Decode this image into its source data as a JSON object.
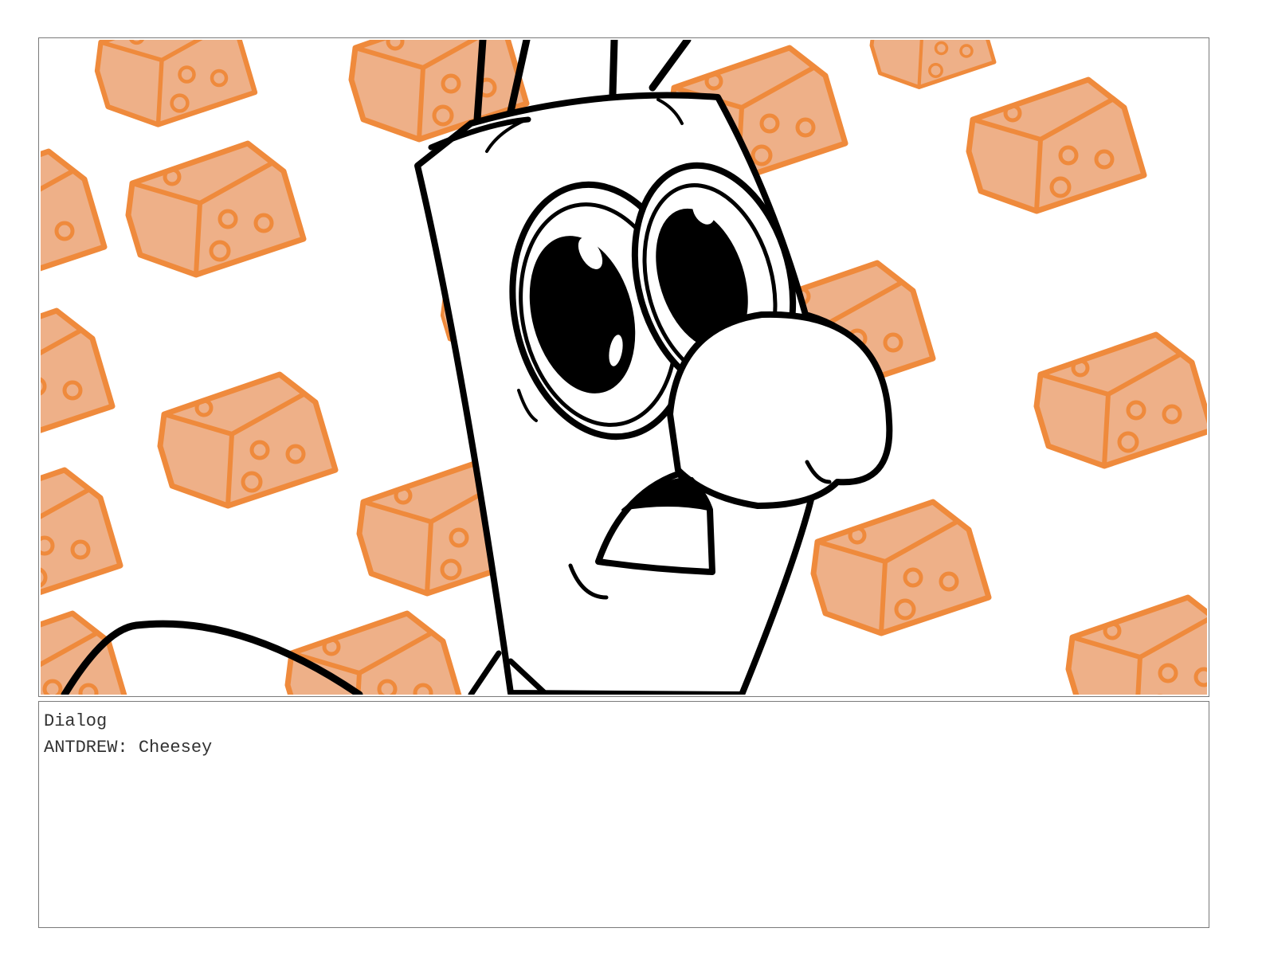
{
  "storyboard": {
    "panel": {
      "image_subject": "cartoon-character-in-front-of-cheese-pattern",
      "cheese_color": "#ef8a3c",
      "cheese_fill": "#eeb088",
      "ink_color": "#000000"
    },
    "dialog": {
      "heading": "Dialog",
      "line": "ANTDREW: Cheesey"
    }
  }
}
